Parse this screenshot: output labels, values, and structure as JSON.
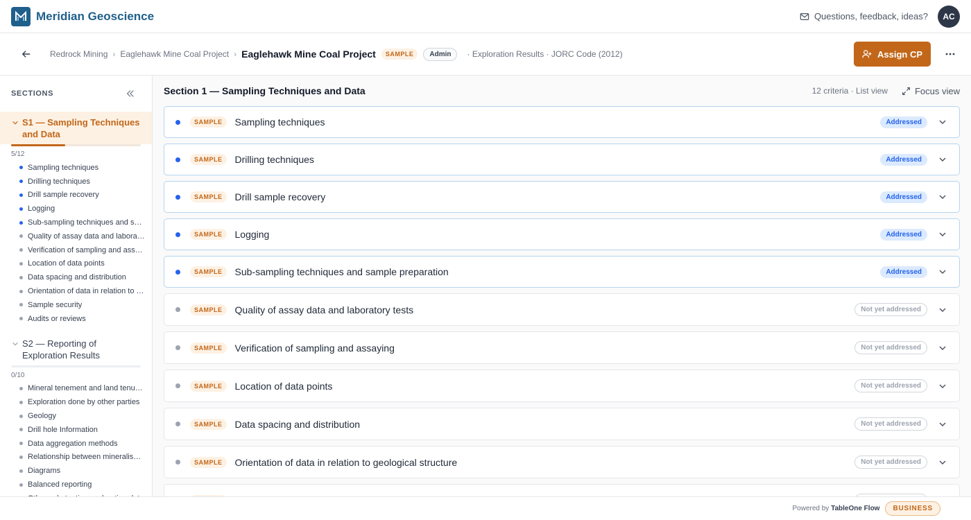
{
  "app": {
    "brand": "Meridian Geoscience",
    "feedback_label": "Questions, feedback, ideas?",
    "avatar_initials": "AC",
    "accent": "#c2671a",
    "brand_color": "#1f5f8b"
  },
  "project": {
    "breadcrumbs": [
      "Redrock Mining",
      "Eaglehawk Mine Coal Project"
    ],
    "title": "Eaglehawk Mine Coal Project",
    "sample_badge": "SAMPLE",
    "role_badge": "Admin",
    "meta": "· Exploration Results · JORC Code (2012)",
    "assign_label": "Assign CP"
  },
  "sidebar": {
    "heading": "SECTIONS",
    "sections": [
      {
        "title": "S1 — Sampling Techniques and Data",
        "count": "5/12",
        "progress": 0.4167,
        "items": [
          {
            "label": "Sampling techniques",
            "addressed": true
          },
          {
            "label": "Drilling techniques",
            "addressed": true
          },
          {
            "label": "Drill sample recovery",
            "addressed": true
          },
          {
            "label": "Logging",
            "addressed": true
          },
          {
            "label": "Sub-sampling techniques and sample preparation",
            "addressed": true
          },
          {
            "label": "Quality of assay data and laboratory tests",
            "addressed": false
          },
          {
            "label": "Verification of sampling and assaying",
            "addressed": false
          },
          {
            "label": "Location of data points",
            "addressed": false
          },
          {
            "label": "Data spacing and distribution",
            "addressed": false
          },
          {
            "label": "Orientation of data in relation to geological structure",
            "addressed": false
          },
          {
            "label": "Sample security",
            "addressed": false
          },
          {
            "label": "Audits or reviews",
            "addressed": false
          }
        ]
      },
      {
        "title": "S2 — Reporting of Exploration Results",
        "count": "0/10",
        "progress": 0,
        "items": [
          {
            "label": "Mineral tenement and land tenure status",
            "addressed": false
          },
          {
            "label": "Exploration done by other parties",
            "addressed": false
          },
          {
            "label": "Geology",
            "addressed": false
          },
          {
            "label": "Drill hole Information",
            "addressed": false
          },
          {
            "label": "Data aggregation methods",
            "addressed": false
          },
          {
            "label": "Relationship between mineralisation widths and intercept lengths",
            "addressed": false
          },
          {
            "label": "Diagrams",
            "addressed": false
          },
          {
            "label": "Balanced reporting",
            "addressed": false
          },
          {
            "label": "Other substantive exploration data",
            "addressed": false
          }
        ]
      }
    ]
  },
  "main": {
    "title": "Section 1 — Sampling Techniques and Data",
    "meta": "12 criteria · List view",
    "focus_label": "Focus view",
    "tag_label": "SAMPLE",
    "status_addressed": "Addressed",
    "status_not": "Not yet addressed",
    "criteria": [
      {
        "title": "Sampling techniques",
        "addressed": true
      },
      {
        "title": "Drilling techniques",
        "addressed": true
      },
      {
        "title": "Drill sample recovery",
        "addressed": true
      },
      {
        "title": "Logging",
        "addressed": true
      },
      {
        "title": "Sub-sampling techniques and sample preparation",
        "addressed": true
      },
      {
        "title": "Quality of assay data and laboratory tests",
        "addressed": false
      },
      {
        "title": "Verification of sampling and assaying",
        "addressed": false
      },
      {
        "title": "Location of data points",
        "addressed": false
      },
      {
        "title": "Data spacing and distribution",
        "addressed": false
      },
      {
        "title": "Orientation of data in relation to geological structure",
        "addressed": false
      },
      {
        "title": "",
        "addressed": false
      }
    ]
  },
  "footer": {
    "powered_prefix": "Powered by",
    "powered_brand": "TableOne Flow",
    "plan": "BUSINESS"
  },
  "colors": {
    "addressed_dot": "#2563eb",
    "pending_dot": "#9ca3af"
  }
}
